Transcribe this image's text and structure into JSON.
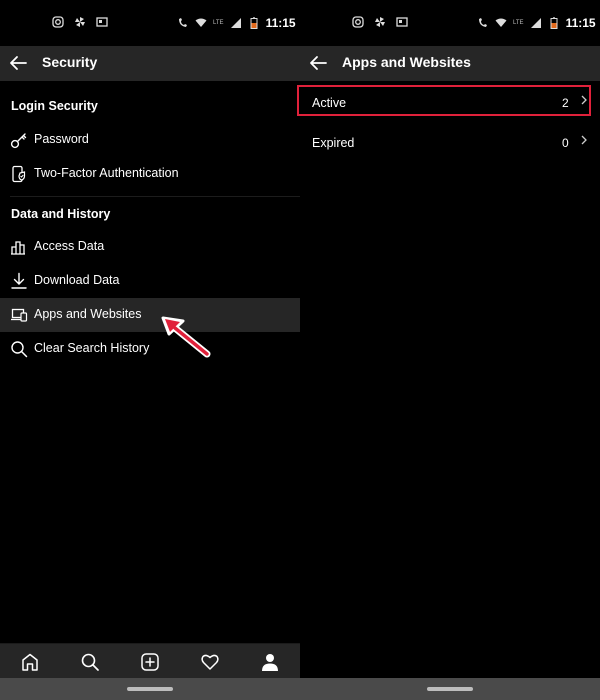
{
  "status_bar": {
    "time": "11:15",
    "network_label": "LTE",
    "icons": [
      "instagram-icon",
      "pinwheel-icon",
      "news-icon",
      "call-lte-icon",
      "wifi-icon",
      "signal-icon",
      "battery-icon"
    ]
  },
  "left_screen": {
    "title": "Security",
    "sections": [
      {
        "header": "Login Security",
        "items": [
          {
            "label": "Password",
            "icon": "key-icon"
          },
          {
            "label": "Two-Factor Authentication",
            "icon": "phone-shield-icon"
          }
        ]
      },
      {
        "header": "Data and History",
        "items": [
          {
            "label": "Access Data",
            "icon": "bar-chart-icon"
          },
          {
            "label": "Download Data",
            "icon": "download-icon"
          },
          {
            "label": "Apps and Websites",
            "icon": "laptop-phone-icon",
            "highlighted": true
          },
          {
            "label": "Clear Search History",
            "icon": "search-icon"
          }
        ]
      }
    ]
  },
  "right_screen": {
    "title": "Apps and Websites",
    "rows": [
      {
        "label": "Active",
        "count": "2",
        "highlighted": true
      },
      {
        "label": "Expired",
        "count": "0"
      }
    ]
  },
  "bottom_nav": [
    "home-icon",
    "search-icon",
    "add-post-icon",
    "heart-icon",
    "profile-icon"
  ],
  "colors": {
    "background": "#000000",
    "app_bar": "#262626",
    "text": "#ffffff",
    "highlight_border": "#e1213b",
    "arrow": "#e1213b"
  }
}
